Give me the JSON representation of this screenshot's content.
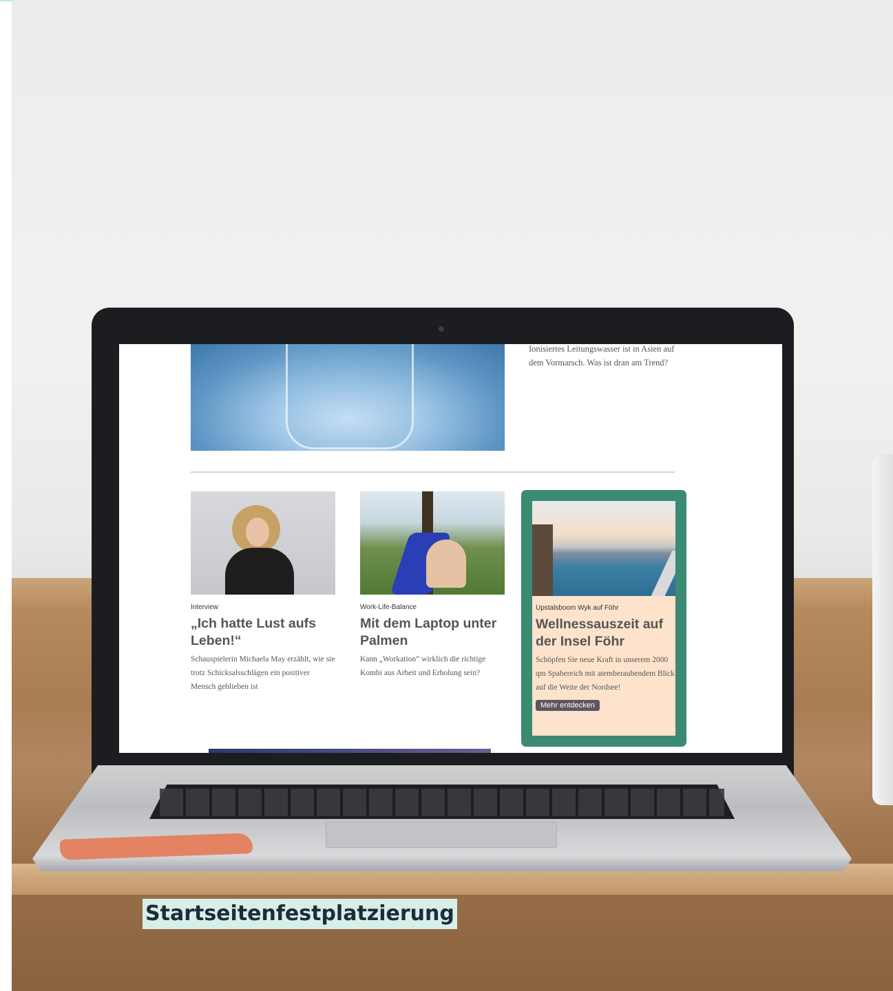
{
  "colors": {
    "accent_frame": "#3b8a73",
    "ad_background": "#fde3cb",
    "cta_background": "#5e5560",
    "caption_highlight": "#d6efe9"
  },
  "screen": {
    "lead_article": {
      "image_icon": "water-glass-photo",
      "teaser": "Ionisiertes Leitungswasser ist in Asien auf dem Vormarsch. Was ist dran am Trend?"
    },
    "cards": [
      {
        "image_icon": "laughing-woman-photo",
        "kicker": "Interview",
        "headline": "„Ich hatte Lust aufs Leben!“",
        "teaser": "Schauspielerin Michaela May erzählt, wie sie trotz Schicksalsschlägen ein positiver Mensch geblieben ist"
      },
      {
        "image_icon": "hammock-park-photo",
        "kicker": "Work-Life-Balance",
        "headline": "Mit dem Laptop unter Palmen",
        "teaser": "Kann „Workation“ wirklich die richtige Kombi aus Arbeit und Erholung sein?"
      }
    ],
    "ad": {
      "image_icon": "infinity-pool-photo",
      "kicker": "Upstalsboom Wyk auf Föhr",
      "headline": "Wellnessauszeit auf der Insel Föhr",
      "teaser": "Schöpfen Sie neue Kraft in unserem 2000 qm Spabereich mit atemberaubendem Blick auf die Weite der Nordsee!",
      "cta": "Mehr entdecken"
    }
  },
  "caption": "Startseitenfestplatzierung"
}
